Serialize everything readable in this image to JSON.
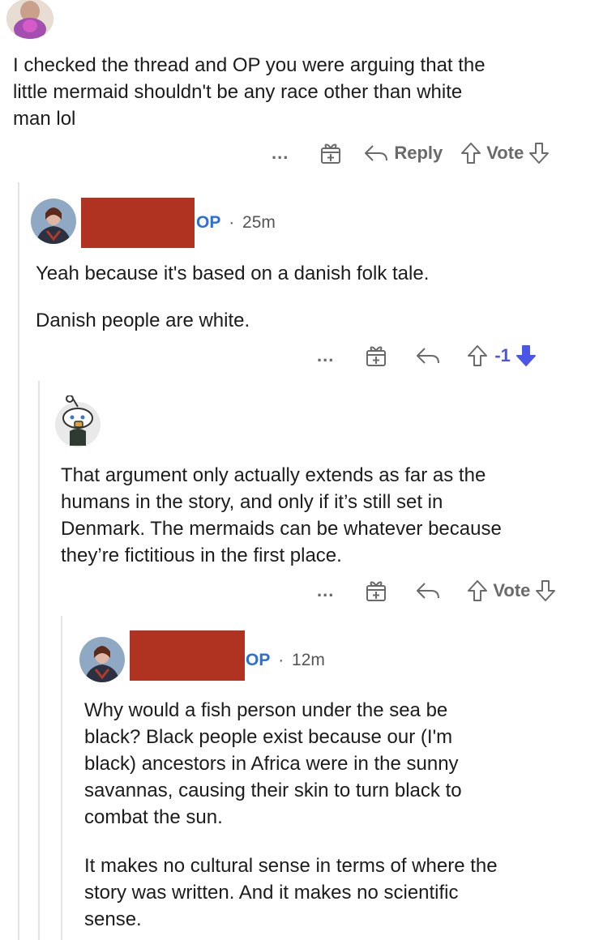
{
  "comments": [
    {
      "text": [
        "I checked the thread and OP you were arguing that the",
        "little mermaid shouldn't be any race other than white",
        "man lol"
      ],
      "actions": {
        "more": "...",
        "reply_label": "Reply",
        "vote_label": "Vote"
      }
    },
    {
      "op_tag": "OP",
      "separator": "·",
      "time": "25m",
      "paragraphs": [
        "Yeah because it's based on a danish folk tale.",
        "Danish people are white."
      ],
      "actions": {
        "more": "...",
        "score": "-1"
      }
    },
    {
      "text": [
        "That argument only actually extends as far as the",
        "humans in the story, and only if it’s still set in",
        "Denmark. The mermaids can be whatever because",
        "they’re fictitious in the first place."
      ],
      "actions": {
        "more": "...",
        "vote_label": "Vote"
      }
    },
    {
      "op_tag": "OP",
      "separator": "·",
      "time": "12m",
      "paragraph1": [
        "Why would a fish person under the sea be",
        "black? Black people exist because our (I'm",
        "black) ancestors in Africa were in the sunny",
        "savannas, causing their skin to turn black to",
        "combat the sun."
      ],
      "paragraph2": [
        "It makes no cultural sense in terms of where the",
        "story was written. And it makes no scientific",
        "sense."
      ]
    }
  ],
  "colors": {
    "op_tag": "#2d6fd6",
    "downvoted": "#4b56e6",
    "redaction": "#b03322",
    "thread_line": "#e4e4e4"
  },
  "icons": [
    "award-icon",
    "reply-icon",
    "upvote-icon",
    "downvote-icon",
    "more-icon"
  ]
}
